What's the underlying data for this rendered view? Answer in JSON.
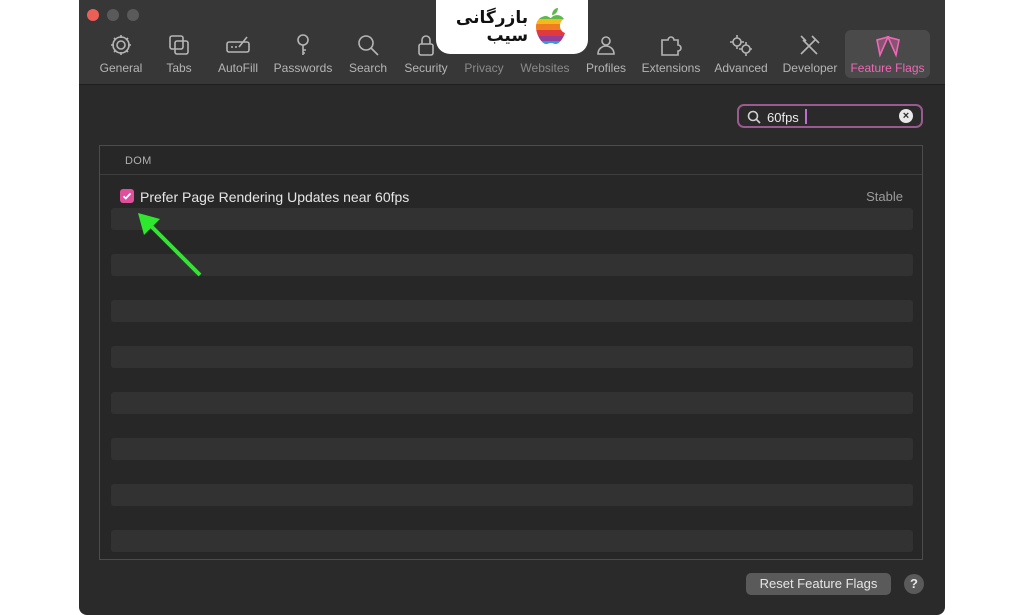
{
  "toolbar": {
    "tabs": [
      {
        "label": "General",
        "icon": "gear-icon"
      },
      {
        "label": "Tabs",
        "icon": "tabs-icon"
      },
      {
        "label": "AutoFill",
        "icon": "autofill-icon"
      },
      {
        "label": "Passwords",
        "icon": "key-icon"
      },
      {
        "label": "Search",
        "icon": "search-icon"
      },
      {
        "label": "Security",
        "icon": "lock-icon"
      },
      {
        "label": "Privacy",
        "icon": "hand-icon"
      },
      {
        "label": "Websites",
        "icon": "globe-icon"
      },
      {
        "label": "Profiles",
        "icon": "person-icon"
      },
      {
        "label": "Extensions",
        "icon": "puzzle-icon"
      },
      {
        "label": "Advanced",
        "icon": "gears-icon"
      },
      {
        "label": "Developer",
        "icon": "tools-icon"
      },
      {
        "label": "Feature Flags",
        "icon": "flags-icon"
      }
    ],
    "active_tab": "Feature Flags",
    "accent_color": "#f067b6"
  },
  "watermark": {
    "text_line1": "بازرگانی",
    "text_line2": "سیب",
    "icon": "apple-logo-icon"
  },
  "search": {
    "value": "60fps",
    "placeholder": ""
  },
  "section": {
    "title": "DOM"
  },
  "flags": [
    {
      "label": "Prefer Page Rendering Updates near 60fps",
      "status": "Stable",
      "checked": true
    }
  ],
  "footer": {
    "reset_label": "Reset Feature Flags",
    "help_label": "?"
  },
  "annotation": {
    "arrow_color": "#2ee82e"
  }
}
